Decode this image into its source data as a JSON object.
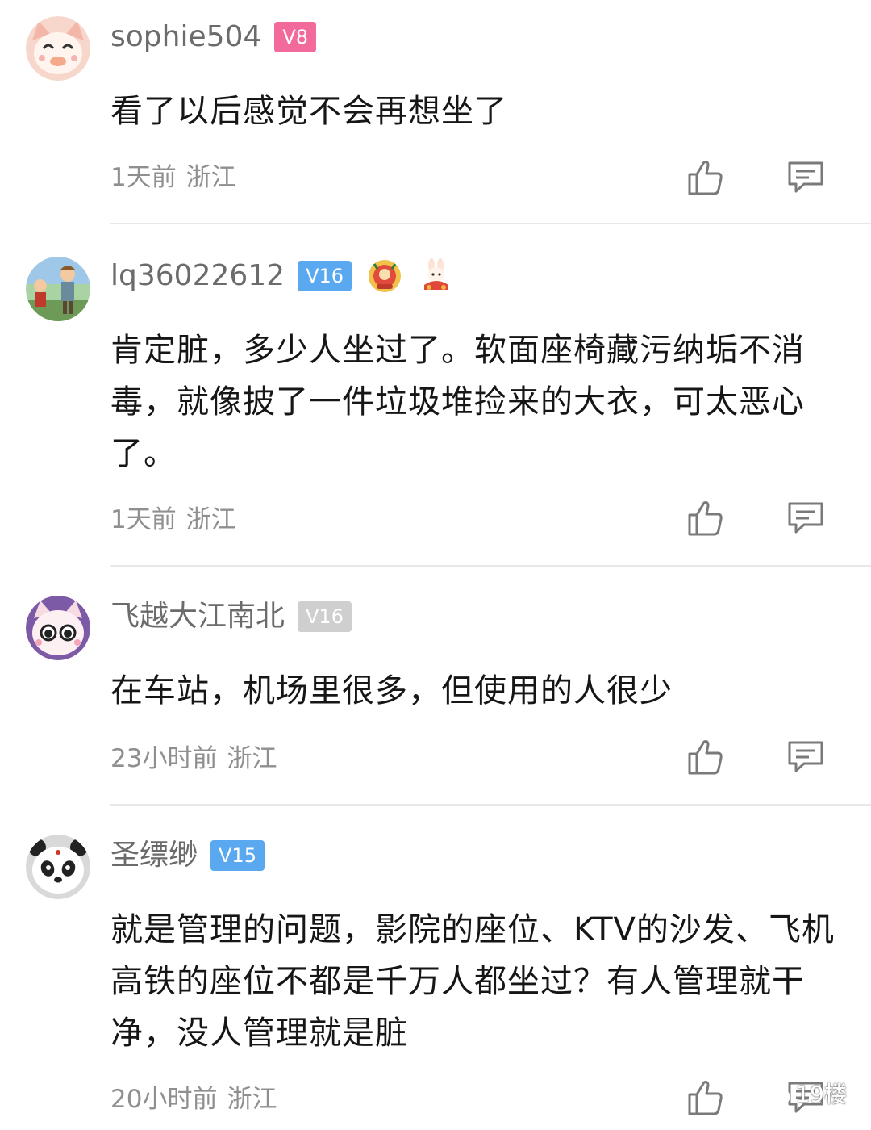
{
  "colors": {
    "badge_pink": "#f26a9b",
    "badge_blue": "#5aa9f0",
    "badge_gray": "#cfcfcf",
    "meta_gray": "#8f8f8f",
    "username_gray": "#6b6b6b"
  },
  "comments": [
    {
      "username": "sophie504",
      "level": "V8",
      "avatar": "cartoon-cat-avatar",
      "text": "看了以后感觉不会再想坐了",
      "time": "1天前",
      "location": "浙江"
    },
    {
      "username": "lq36022612",
      "level": "V16",
      "avatar": "illustrated-people-avatar",
      "medals": [
        "festival-medal-icon",
        "rabbit-medal-icon"
      ],
      "text": "肯定脏，多少人坐过了。软面座椅藏污纳垢不消毒，就像披了一件垃圾堆捡来的大衣，可太恶心了。",
      "time": "1天前",
      "location": "浙江"
    },
    {
      "username": "飞越大江南北",
      "level": "V16",
      "avatar": "cartoon-cat-avatar",
      "text": "在车站，机场里很多，但使用的人很少",
      "time": "23小时前",
      "location": "浙江"
    },
    {
      "username": "圣缥缈",
      "level": "V15",
      "avatar": "panda-avatar",
      "text": "就是管理的问题，影院的座位、KTV的沙发、飞机高铁的座位不都是千万人都坐过？有人管理就干净，没人管理就是脏",
      "time": "20小时前",
      "location": "浙江"
    }
  ],
  "watermark": {
    "text": "19楼",
    "icon": "wechat-icon"
  }
}
